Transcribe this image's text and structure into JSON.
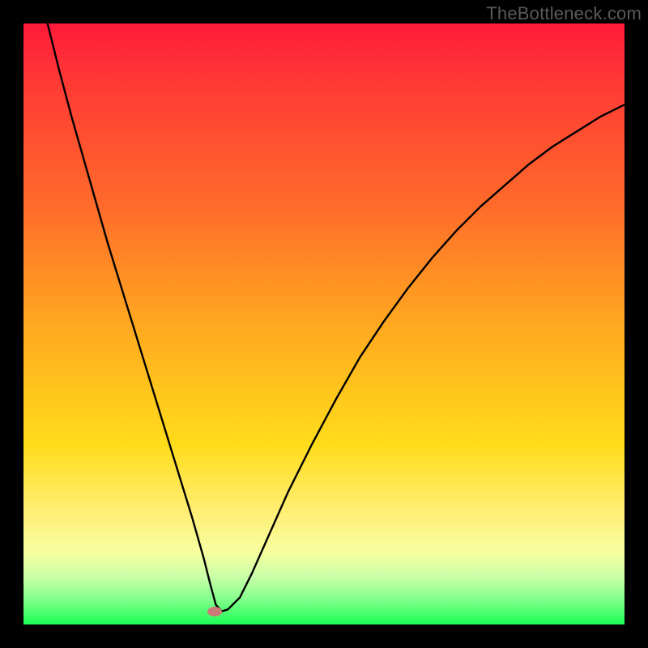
{
  "watermark": {
    "text": "TheBottleneck.com"
  },
  "colors": {
    "curve": "#000000",
    "marker": "#cc7a77",
    "frame": "#000000"
  },
  "chart_data": {
    "type": "line",
    "title": "",
    "xlabel": "",
    "ylabel": "",
    "xlim": [
      0,
      100
    ],
    "ylim": [
      0,
      100
    ],
    "grid": false,
    "legend": false,
    "marker": {
      "x": 31.8,
      "y": 2.2
    },
    "series": [
      {
        "name": "bottleneck-curve",
        "x": [
          4,
          6,
          8,
          10,
          12,
          14,
          16,
          18,
          20,
          22,
          24,
          26,
          28,
          30,
          31,
          32,
          33,
          34,
          36,
          38,
          40,
          44,
          48,
          52,
          56,
          60,
          64,
          68,
          72,
          76,
          80,
          84,
          88,
          92,
          96,
          100
        ],
        "y": [
          100,
          92,
          84.5,
          77.5,
          70.5,
          63.5,
          57,
          50.5,
          44,
          37.5,
          31,
          24.5,
          18,
          11,
          7,
          3.3,
          2.2,
          2.5,
          4.5,
          8.5,
          13,
          22,
          30,
          37.5,
          44.5,
          50.5,
          56,
          61,
          65.5,
          69.5,
          73,
          76.5,
          79.5,
          82,
          84.5,
          86.5
        ]
      }
    ]
  }
}
